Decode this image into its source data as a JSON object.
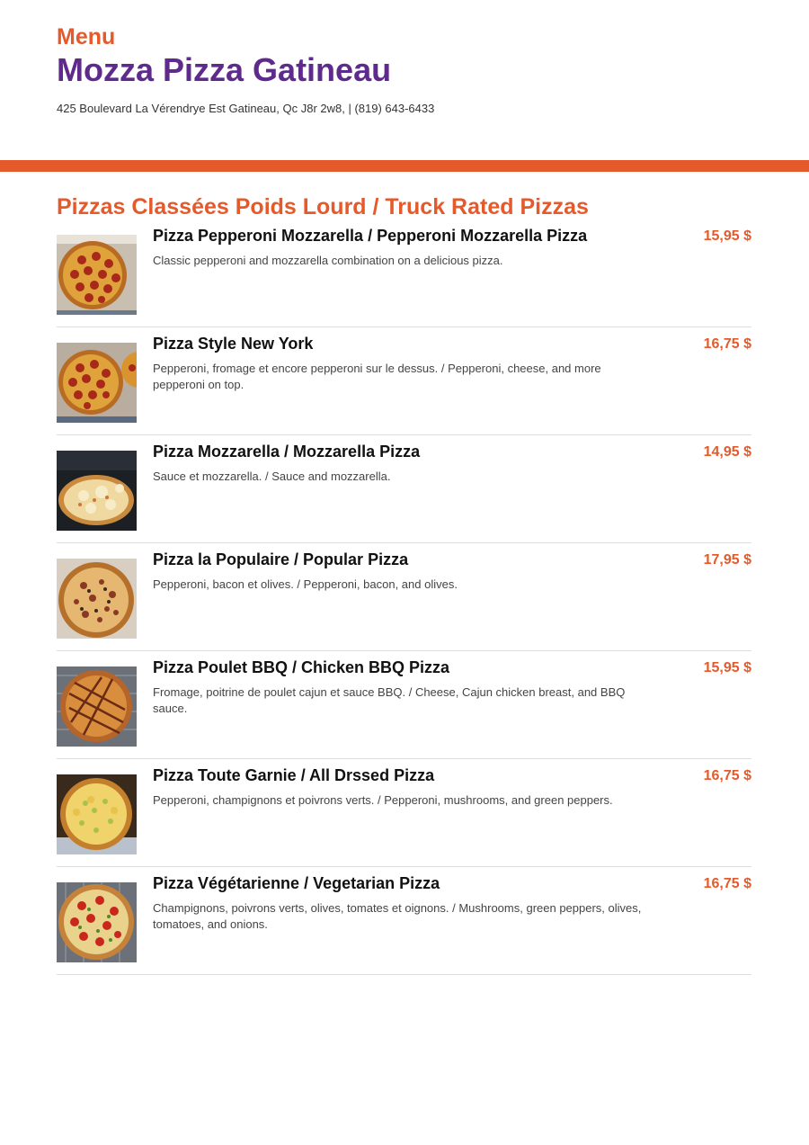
{
  "header": {
    "menu_label": "Menu",
    "restaurant_name": "Mozza Pizza Gatineau",
    "address": "425 Boulevard La Vérendrye Est Gatineau, Qc J8r 2w8, | (819) 643-6433"
  },
  "section": {
    "title": "Pizzas Classées Poids Lourd / Truck Rated Pizzas"
  },
  "items": [
    {
      "name": "Pizza Pepperoni Mozzarella / Pepperoni Mozzarella Pizza",
      "description": "Classic pepperoni and mozzarella combination on a delicious pizza.",
      "price": "15,95 $",
      "image": "pepperoni-pizza"
    },
    {
      "name": "Pizza Style New York",
      "description": "Pepperoni, fromage et encore pepperoni sur le dessus. / Pepperoni, cheese, and more pepperoni on top.",
      "price": "16,75 $",
      "image": "pepperoni-pizza"
    },
    {
      "name": "Pizza Mozzarella / Mozzarella Pizza",
      "description": "Sauce et mozzarella. / Sauce and mozzarella.",
      "price": "14,95 $",
      "image": "cheese-pizza"
    },
    {
      "name": "Pizza la Populaire / Popular Pizza",
      "description": "Pepperoni, bacon et olives. / Pepperoni, bacon, and olives.",
      "price": "17,95 $",
      "image": "popular-pizza"
    },
    {
      "name": "Pizza Poulet BBQ / Chicken BBQ Pizza",
      "description": "Fromage, poitrine de poulet cajun et sauce BBQ. / Cheese, Cajun chicken breast, and BBQ sauce.",
      "price": "15,95 $",
      "image": "bbq-chicken-pizza"
    },
    {
      "name": "Pizza Toute Garnie / All Drssed Pizza",
      "description": "Pepperoni, champignons et poivrons verts. / Pepperoni, mushrooms, and green peppers.",
      "price": "16,75 $",
      "image": "all-dressed-pizza"
    },
    {
      "name": "Pizza Végétarienne / Vegetarian Pizza",
      "description": "Champignons, poivrons verts, olives, tomates et oignons. / Mushrooms, green peppers, olives, tomatoes, and onions.",
      "price": "16,75 $",
      "image": "vegetarian-pizza"
    }
  ],
  "colors": {
    "accent_orange": "#e55a2b",
    "brand_purple": "#5e2b8c"
  }
}
